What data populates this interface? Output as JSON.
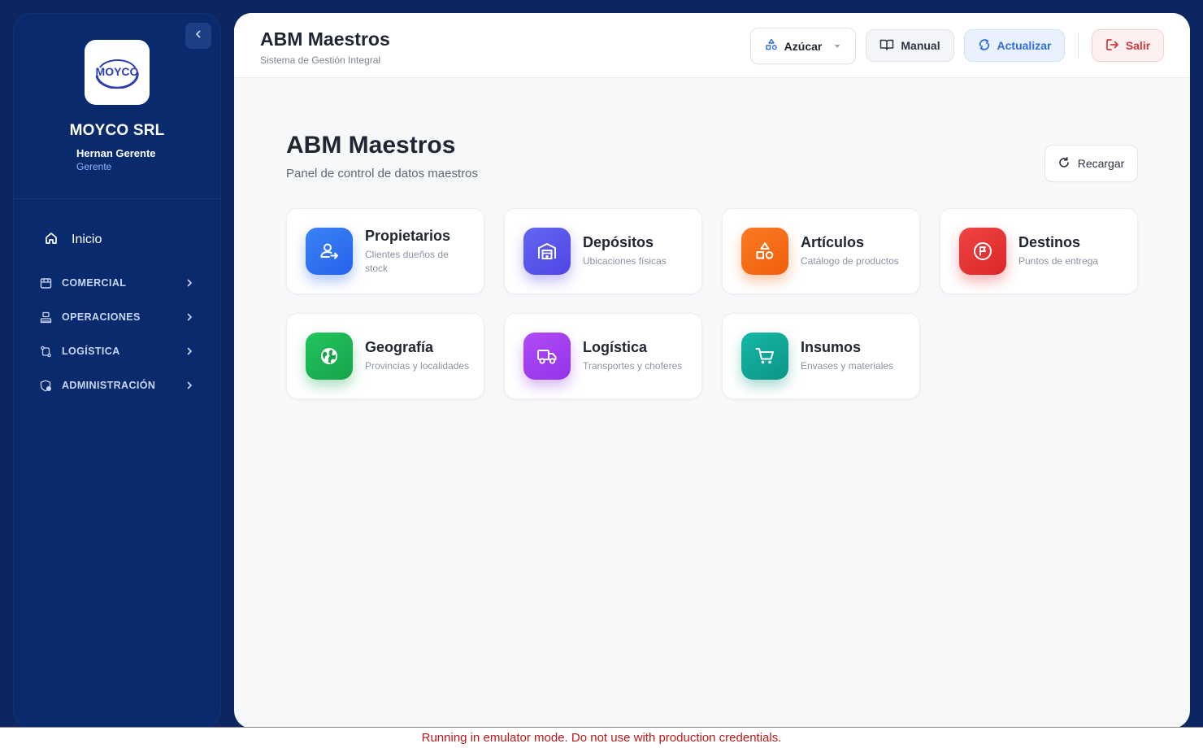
{
  "sidebar": {
    "company": "MOYCO SRL",
    "logo_text": "MOYCO",
    "user_name": "Hernan Gerente",
    "user_role": "Gerente",
    "home_label": "Inicio",
    "groups": [
      {
        "label": "COMERCIAL",
        "icon": "store-icon"
      },
      {
        "label": "OPERACIONES",
        "icon": "inventory-icon"
      },
      {
        "label": "LOGÍSTICA",
        "icon": "route-icon"
      },
      {
        "label": "ADMINISTRACIÓN",
        "icon": "admin-shield-icon"
      }
    ]
  },
  "topbar": {
    "title": "ABM Maestros",
    "subtitle": "Sistema de Gestión Integral",
    "product_selector": "Azúcar",
    "manual_label": "Manual",
    "refresh_label": "Actualizar",
    "exit_label": "Salir"
  },
  "page": {
    "title": "ABM Maestros",
    "subtitle": "Panel de control de datos maestros",
    "reload_label": "Recargar"
  },
  "cards": [
    {
      "title": "Propietarios",
      "desc": "Clientes dueños de stock",
      "icon": "owners-icon",
      "color": "#2563eb"
    },
    {
      "title": "Depósitos",
      "desc": "Ubicaciones físicas",
      "icon": "warehouse-icon",
      "color": "#4f46e5"
    },
    {
      "title": "Artículos",
      "desc": "Catálogo de productos",
      "icon": "shapes-icon",
      "color": "#f05f0c"
    },
    {
      "title": "Destinos",
      "desc": "Puntos de entrega",
      "icon": "destination-icon",
      "color": "#dc2626"
    },
    {
      "title": "Geografía",
      "desc": "Provincias y localidades",
      "icon": "globe-icon",
      "color": "#16a34a"
    },
    {
      "title": "Logística",
      "desc": "Transportes y choferes",
      "icon": "truck-icon",
      "color": "#9333ea"
    },
    {
      "title": "Insumos",
      "desc": "Envases y materiales",
      "icon": "cart-icon",
      "color": "#0d9488"
    }
  ],
  "banner": "Running in emulator mode. Do not use with production credentials."
}
